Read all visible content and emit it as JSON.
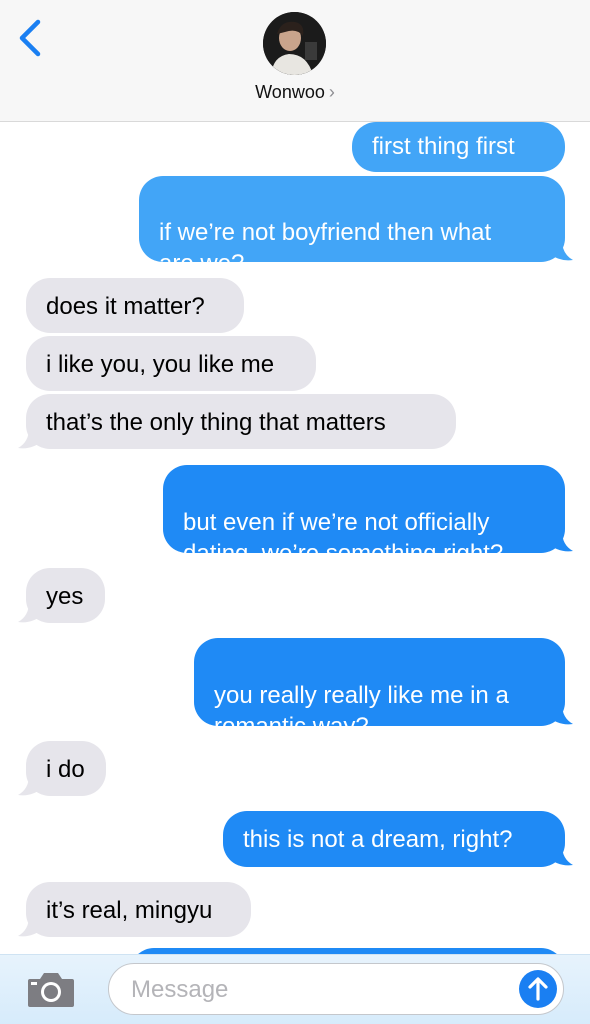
{
  "header": {
    "back_icon": "chevron-left-icon",
    "contact_name": "Wonwoo",
    "contact_chevron": "›"
  },
  "messages": [
    {
      "direction": "out",
      "text": "first thing first"
    },
    {
      "direction": "out",
      "text": "if we’re not boyfriend then what\nare we?"
    },
    {
      "direction": "in",
      "text": "does it matter?"
    },
    {
      "direction": "in",
      "text": "i like you, you like me"
    },
    {
      "direction": "in",
      "text": "that’s the only thing that matters"
    },
    {
      "direction": "out",
      "text": "but even if we’re not officially\ndating, we’re something right?"
    },
    {
      "direction": "in",
      "text": "yes"
    },
    {
      "direction": "out",
      "text": "you really really like me in a\nromantic way?"
    },
    {
      "direction": "in",
      "text": "i do"
    },
    {
      "direction": "out",
      "text": "this is not a dream, right?"
    },
    {
      "direction": "in",
      "text": "it’s real, mingyu"
    }
  ],
  "input_bar": {
    "camera_icon": "camera-icon",
    "placeholder": "Message",
    "send_icon": "arrow-up-icon"
  },
  "colors": {
    "outgoing_bubble": "#1f8af5",
    "incoming_bubble": "#e6e5eb",
    "accent": "#1a7ff2"
  }
}
